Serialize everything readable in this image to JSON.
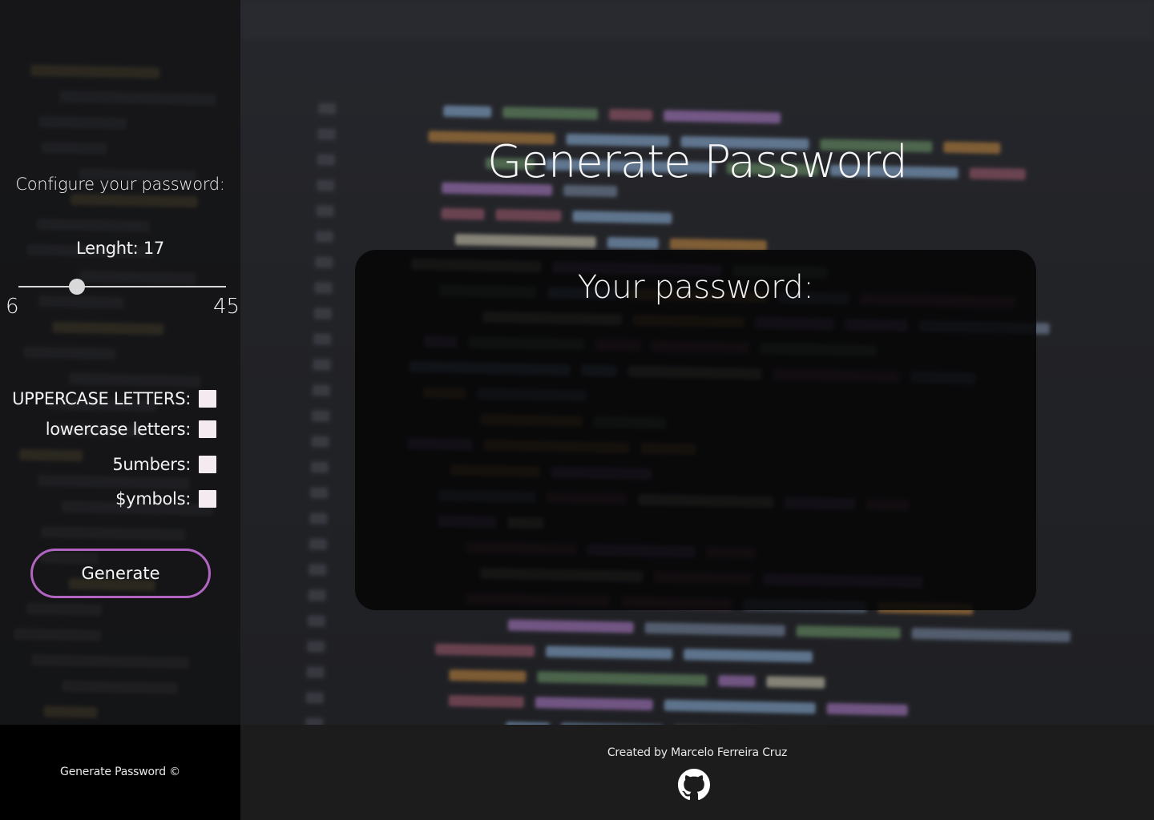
{
  "sidebar": {
    "title": "Configure your password:",
    "length_label": "Lenght: 17",
    "length": {
      "min": 6,
      "max": 45,
      "value": 17,
      "min_label": "6",
      "max_label": "45"
    },
    "options": [
      {
        "label": "UPPERCASE LETTERS:",
        "checked": false
      },
      {
        "label": "lowercase letters:",
        "checked": false
      },
      {
        "label": "5umbers:",
        "checked": false
      },
      {
        "label": "$ymbols:",
        "checked": false
      }
    ],
    "generate_label": "Generate"
  },
  "main": {
    "title": "Generate Password",
    "password_heading": "Your password:",
    "password_value": ""
  },
  "footer": {
    "left_text": "Generate Password ©",
    "credit": "Created by Marcelo Ferreira Cruz",
    "icon": "github-icon"
  },
  "colors": {
    "accent": "#b164c2",
    "checkbox": "#f4ebf0",
    "panel": "#060607"
  }
}
